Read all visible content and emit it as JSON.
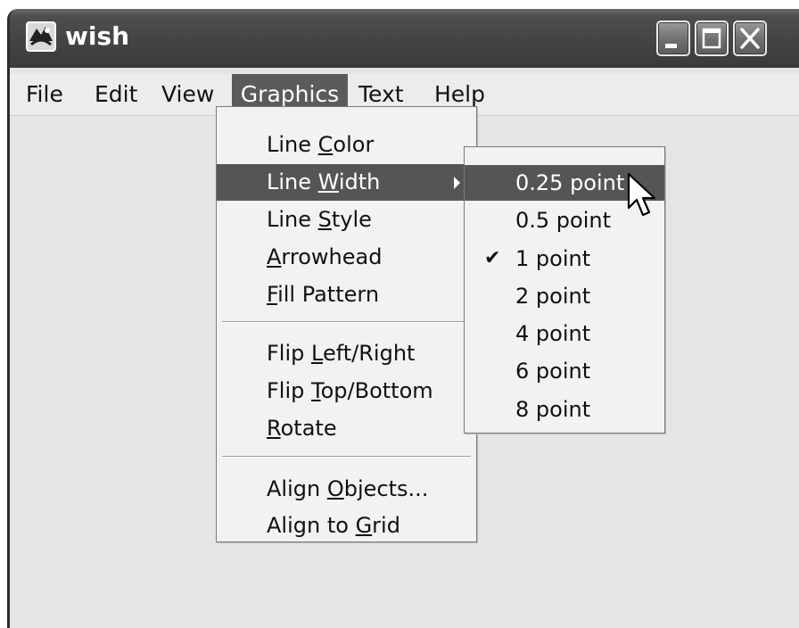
{
  "window": {
    "title": "wish"
  },
  "menubar": {
    "items": [
      {
        "label": "File"
      },
      {
        "label": "Edit"
      },
      {
        "label": "View"
      },
      {
        "label": "Graphics"
      },
      {
        "label": "Text"
      },
      {
        "label": "Help"
      }
    ],
    "active": "Graphics"
  },
  "graphics_menu": {
    "items": [
      {
        "pre": "Line ",
        "mn": "C",
        "post": "olor"
      },
      {
        "pre": "Line ",
        "mn": "W",
        "post": "idth",
        "has_submenu": true,
        "highlighted": true
      },
      {
        "pre": "Line ",
        "mn": "S",
        "post": "tyle"
      },
      {
        "pre": "",
        "mn": "A",
        "post": "rrowhead"
      },
      {
        "pre": "",
        "mn": "F",
        "post": "ill Pattern"
      },
      {
        "pre": "Flip ",
        "mn": "L",
        "post": "eft/Right"
      },
      {
        "pre": "Flip ",
        "mn": "T",
        "post": "op/Bottom"
      },
      {
        "pre": "",
        "mn": "R",
        "post": "otate"
      },
      {
        "pre": "Align ",
        "mn": "O",
        "post": "bjects..."
      },
      {
        "pre": "Align to ",
        "mn": "G",
        "post": "rid"
      }
    ]
  },
  "line_width_submenu": {
    "items": [
      {
        "label": "0.25 point",
        "highlighted": true
      },
      {
        "label": "0.5 point"
      },
      {
        "label": "1 point",
        "checked": true
      },
      {
        "label": "2 point"
      },
      {
        "label": "4 point"
      },
      {
        "label": "6 point"
      },
      {
        "label": "8 point"
      }
    ],
    "check_glyph": "✔"
  },
  "icons": {
    "app": "wish-app-icon",
    "minimize": "minimize-icon",
    "maximize": "maximize-icon",
    "close": "close-icon",
    "cursor": "mouse-pointer-icon",
    "submenu": "submenu-arrow-icon",
    "check": "checkmark-icon"
  },
  "colors": {
    "highlight": "#555555",
    "menu_background": "#f2f2f2",
    "window_background": "#e5e5e5",
    "titlebar": "#444444"
  }
}
